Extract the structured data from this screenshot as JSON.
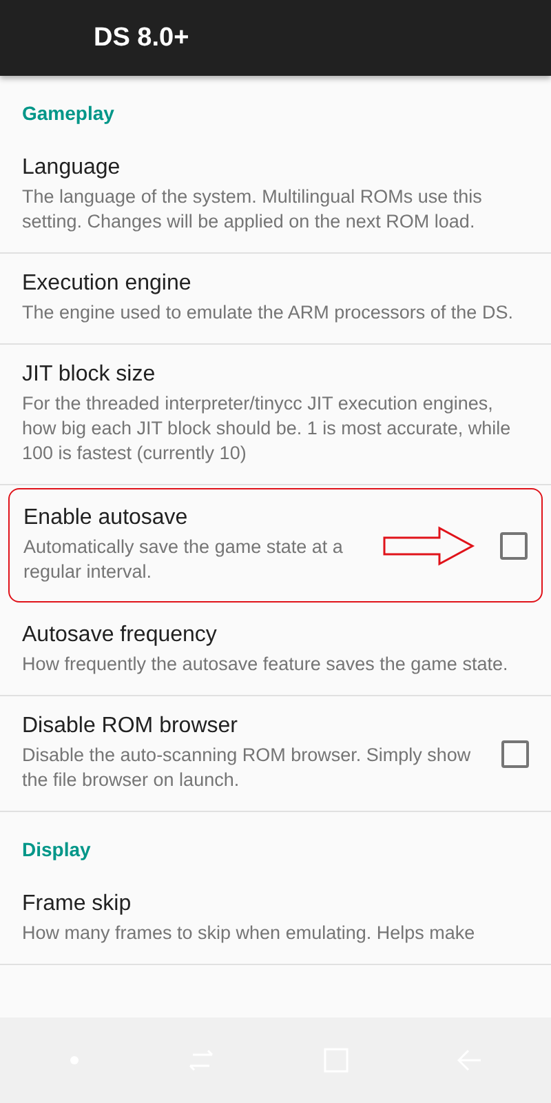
{
  "app_bar": {
    "title": "DS 8.0+"
  },
  "sections": [
    {
      "title": "Gameplay",
      "items": [
        {
          "kind": "plain",
          "title": "Language",
          "summary": "The language of the system. Multilingual ROMs use this setting. Changes will be applied on the next ROM load."
        },
        {
          "kind": "plain",
          "title": "Execution engine",
          "summary": "The engine used to emulate the ARM processors of the DS."
        },
        {
          "kind": "plain",
          "title": "JIT block size",
          "summary": "For the threaded interpreter/tinycc JIT execution engines, how big each JIT block should be. 1 is most accurate, while 100 is fastest (currently 10)"
        },
        {
          "kind": "checkbox",
          "title": "Enable autosave",
          "summary": "Automatically save the game state at a regular interval.",
          "checked": false,
          "highlighted": true
        },
        {
          "kind": "plain",
          "title": "Autosave frequency",
          "summary": "How frequently the autosave feature saves the game state."
        },
        {
          "kind": "checkbox",
          "title": "Disable ROM browser",
          "summary": "Disable the auto-scanning ROM browser. Simply show the file browser on launch.",
          "checked": false,
          "highlighted": false
        }
      ]
    },
    {
      "title": "Display",
      "items": [
        {
          "kind": "plain",
          "title": "Frame skip",
          "summary": "How many frames to skip when emulating. Helps make"
        }
      ]
    }
  ]
}
